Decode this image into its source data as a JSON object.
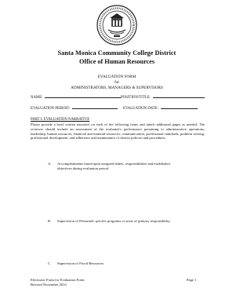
{
  "header": {
    "seal_icon": "college-seal-icon",
    "district": "Santa Monica Community College District",
    "office": "Office of Human Resources"
  },
  "form": {
    "title": "EVALUATION FORM",
    "for": "for",
    "subtitle": "ADMINISTRATORS, MANAGERS & SUPERVISORS"
  },
  "fields": {
    "name_label": "NAME:",
    "position_label": "POSITION/TITLE:",
    "period_label": "EVALUATION PERIOD:",
    "date_label": "EVALUATION DATE:"
  },
  "part1": {
    "heading": "PART I: EVALUATION NARRATIVE",
    "narrative": "Please provide a brief written narrative on each of the following items and attach additional pages as needed. The reviewer should include an assessment of the evaluatee's performance pertaining to administrative operations, leadership, human resources, financial and material resources, communication, professional standards, problem solving, professional development, and adherence and maintenance of district policies and procedures.",
    "items": [
      {
        "letter": "A.",
        "line1": "Accomplishments based upon assigned duties, responsibilities and established",
        "line2": "objectives during evaluation period."
      },
      {
        "letter": "B.",
        "line1": "Supervision of Personnel, specific programs or areas of primary responsibility.",
        "line2": ""
      },
      {
        "letter": "C.",
        "line1": "Supervision of Fiscal Resources.",
        "line2": ""
      }
    ]
  },
  "footer": {
    "left_line1": "Electronic Form for Evaluation Form",
    "left_line2": "Revised November 2014",
    "page": "Page 1"
  }
}
